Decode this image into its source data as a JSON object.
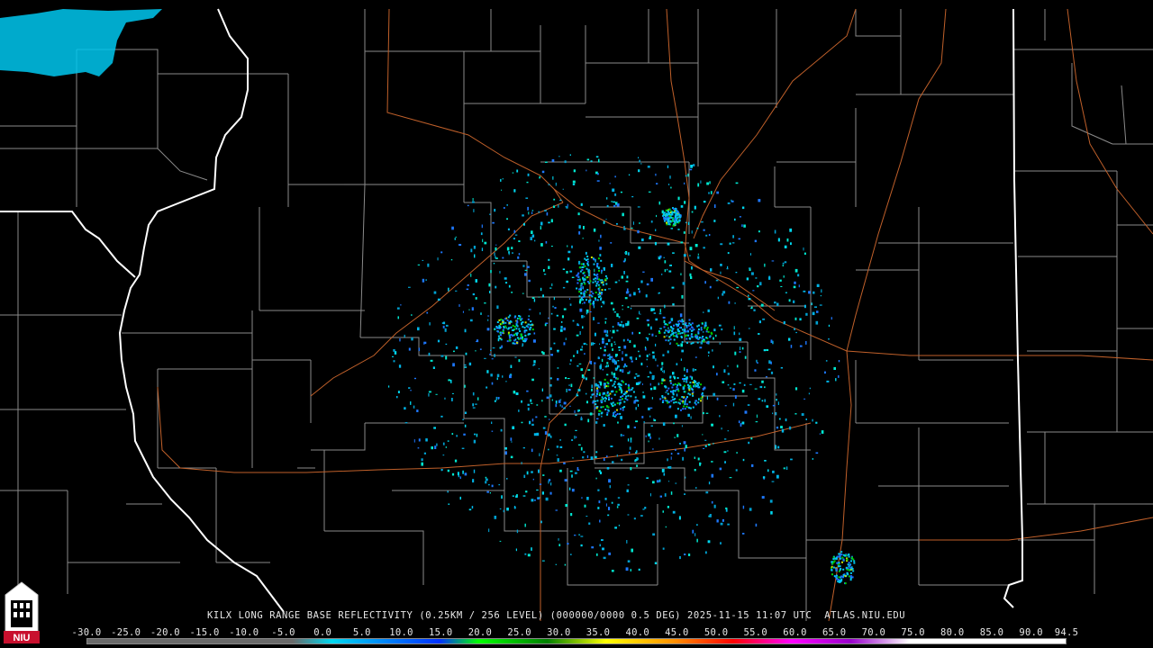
{
  "map": {
    "title": "KILX LONG RANGE BASE REFLECTIVITY (0.25KM / 256 LEVEL) (000000/0000 0.5 DEG) 2025-11-15 11:07 UTC  ATLAS.NIU.EDU",
    "radar_site": "KILX",
    "logo_text": "NIU"
  },
  "colorbar": {
    "ticks": [
      "-30.0",
      "-25.0",
      "-20.0",
      "-15.0",
      "-10.0",
      "-5.0",
      "0.0",
      "5.0",
      "10.0",
      "15.0",
      "20.0",
      "25.0",
      "30.0",
      "35.0",
      "40.0",
      "45.0",
      "50.0",
      "55.0",
      "60.0",
      "65.0",
      "70.0",
      "75.0",
      "80.0",
      "85.0",
      "90.0",
      "94.5"
    ],
    "colors": {
      "low": "#6a6a6a",
      "cyan": "#00d8f0",
      "blue": "#0030ff",
      "green": "#00ff00",
      "dark_green": "#008000",
      "yellow": "#ffff00",
      "orange": "#ff9000",
      "red": "#ff0000",
      "magenta": "#ff00ff",
      "purple": "#9900cc",
      "white": "#ffffff"
    }
  }
}
